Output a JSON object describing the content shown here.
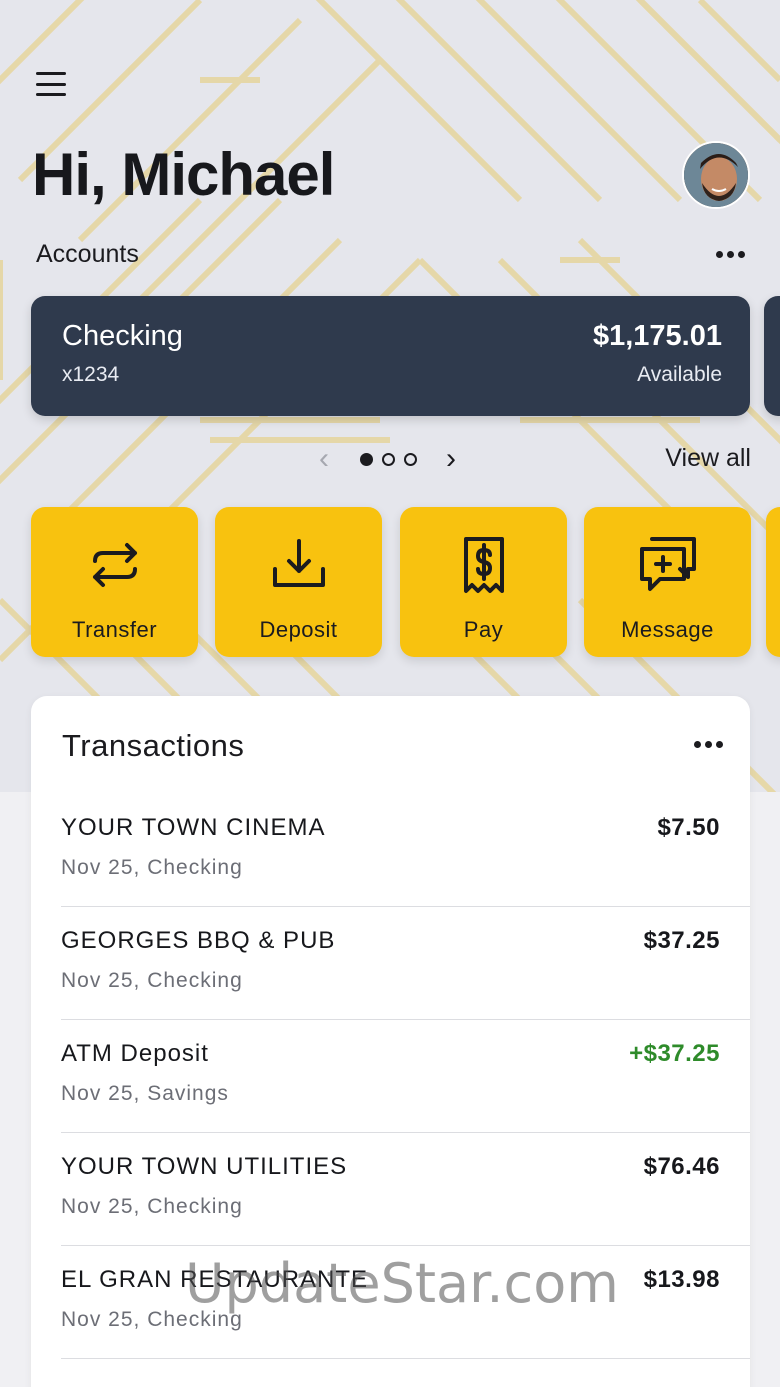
{
  "header": {
    "greeting": "Hi, Michael",
    "accounts_label": "Accounts"
  },
  "account": {
    "name": "Checking",
    "number": "x1234",
    "balance": "$1,175.01",
    "balance_label": "Available"
  },
  "pager": {
    "page_count": 3,
    "active_page": 1,
    "view_all": "View all"
  },
  "actions": [
    {
      "label": "Transfer",
      "icon": "transfer-icon"
    },
    {
      "label": "Deposit",
      "icon": "deposit-icon"
    },
    {
      "label": "Pay",
      "icon": "pay-bill-icon"
    },
    {
      "label": "Message",
      "icon": "message-add-icon"
    }
  ],
  "transactions": {
    "title": "Transactions",
    "items": [
      {
        "name": "YOUR TOWN CINEMA",
        "sub": "Nov 25, Checking",
        "amount": "$7.50"
      },
      {
        "name": "GEORGES BBQ & PUB",
        "sub": "Nov 25, Checking",
        "amount": "$37.25"
      },
      {
        "name": "ATM Deposit",
        "sub": "Nov 25, Savings",
        "amount": "+$37.25"
      },
      {
        "name": "YOUR TOWN UTILITIES",
        "sub": "Nov 25, Checking",
        "amount": "$76.46"
      },
      {
        "name": "EL GRAN RESTAURANTE",
        "sub": "Nov 25, Checking",
        "amount": "$13.98"
      }
    ]
  },
  "watermark": "UpdateStar.com",
  "colors": {
    "accent": "#f8c20f",
    "card": "#2f3a4d",
    "credit": "#2e8b2a",
    "pattern": "#e6d6a1"
  }
}
